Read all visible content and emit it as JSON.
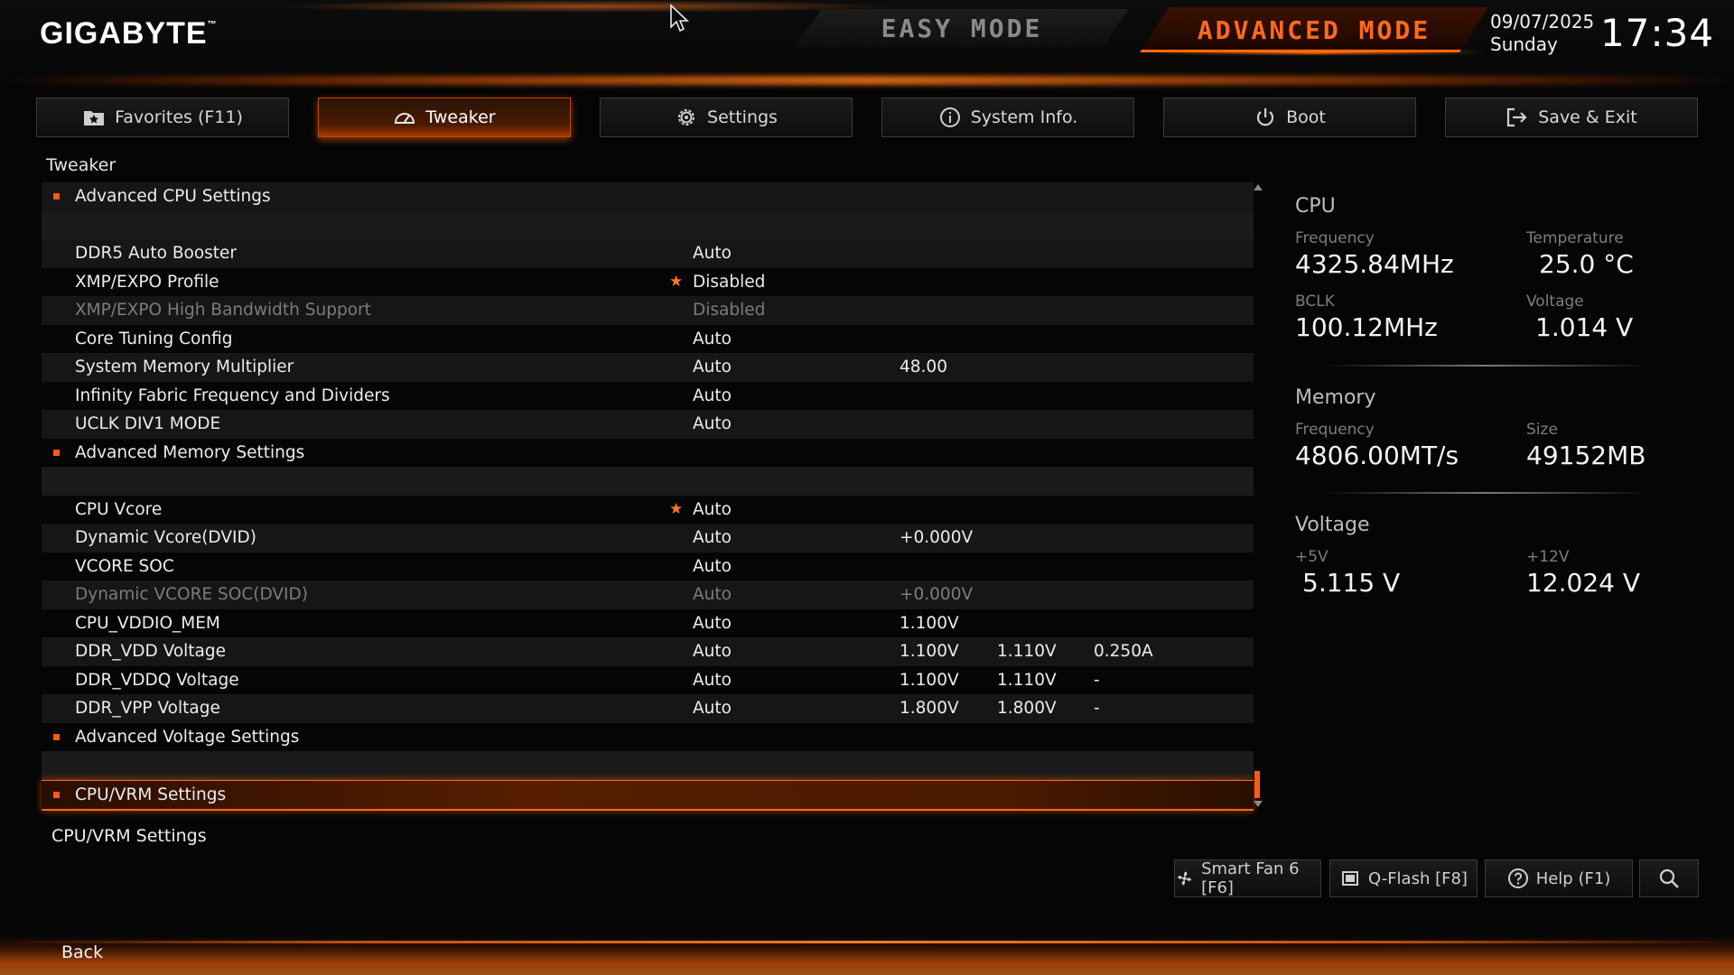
{
  "header": {
    "logo": "GIGABYTE",
    "logo_tm": "™",
    "easy_mode": "EASY MODE",
    "advanced_mode": "ADVANCED MODE",
    "date": "09/07/2025",
    "day": "Sunday",
    "time": "17:34"
  },
  "tabs": [
    {
      "label": "Favorites (F11)",
      "icon": "folder-star-icon"
    },
    {
      "label": "Tweaker",
      "icon": "speedometer-icon"
    },
    {
      "label": "Settings",
      "icon": "gear-icon"
    },
    {
      "label": "System Info.",
      "icon": "info-icon"
    },
    {
      "label": "Boot",
      "icon": "power-icon"
    },
    {
      "label": "Save & Exit",
      "icon": "exit-icon"
    }
  ],
  "breadcrumb": "Tweaker",
  "rows": [
    {
      "name": "Advanced CPU Settings",
      "submenu": true
    },
    {
      "blank": true
    },
    {
      "name": "DDR5 Auto Booster",
      "value": "Auto"
    },
    {
      "name": "XMP/EXPO Profile",
      "value": "Disabled",
      "starred": true
    },
    {
      "name": "XMP/EXPO High Bandwidth Support",
      "value": "Disabled",
      "disabled": true
    },
    {
      "name": "Core Tuning Config",
      "value": "Auto"
    },
    {
      "name": "System Memory Multiplier",
      "value": "Auto",
      "v2": "48.00"
    },
    {
      "name": "Infinity Fabric Frequency and Dividers",
      "value": "Auto"
    },
    {
      "name": "UCLK DIV1 MODE",
      "value": "Auto"
    },
    {
      "name": "Advanced Memory Settings",
      "submenu": true
    },
    {
      "blank": true
    },
    {
      "name": "CPU Vcore",
      "value": "Auto",
      "starred": true
    },
    {
      "name": "Dynamic Vcore(DVID)",
      "value": "Auto",
      "v2": "+0.000V"
    },
    {
      "name": "VCORE SOC",
      "value": "Auto"
    },
    {
      "name": "Dynamic VCORE SOC(DVID)",
      "value": "Auto",
      "v2": "+0.000V",
      "disabled": true
    },
    {
      "name": "CPU_VDDIO_MEM",
      "value": "Auto",
      "v2": "1.100V"
    },
    {
      "name": "DDR_VDD Voltage",
      "value": "Auto",
      "v2": "1.100V",
      "v3": "1.110V",
      "v4": "0.250A"
    },
    {
      "name": "DDR_VDDQ Voltage",
      "value": "Auto",
      "v2": "1.100V",
      "v3": "1.110V",
      "v4": "-"
    },
    {
      "name": "DDR_VPP Voltage",
      "value": "Auto",
      "v2": "1.800V",
      "v3": "1.800V",
      "v4": "-"
    },
    {
      "name": "Advanced Voltage Settings",
      "submenu": true
    },
    {
      "blank": true
    },
    {
      "name": "CPU/VRM Settings",
      "submenu": true,
      "selected": true
    }
  ],
  "help_text": "CPU/VRM Settings",
  "info": {
    "cpu": {
      "title": "CPU",
      "freq_label": "Frequency",
      "freq": "4325.84MHz",
      "temp_label": "Temperature",
      "temp": "25.0 °C",
      "bclk_label": "BCLK",
      "bclk": "100.12MHz",
      "volt_label": "Voltage",
      "volt": "1.014 V"
    },
    "memory": {
      "title": "Memory",
      "freq_label": "Frequency",
      "freq": "4806.00MT/s",
      "size_label": "Size",
      "size": "49152MB"
    },
    "voltage": {
      "title": "Voltage",
      "p5_label": "+5V",
      "p5": "5.115 V",
      "p12_label": "+12V",
      "p12": "12.024 V"
    }
  },
  "bottom_buttons": [
    {
      "label": "Smart Fan 6 [F6]",
      "icon": "fan-icon"
    },
    {
      "label": "Q-Flash [F8]",
      "icon": "chip-icon"
    },
    {
      "label": "Help (F1)",
      "icon": "help-icon"
    },
    {
      "label": "",
      "icon": "search-icon"
    }
  ],
  "footer": {
    "back": "Back"
  },
  "colors": {
    "accent": "#ff6a10",
    "background": "#050505",
    "text": "#ececec",
    "disabled": "#7c7c7c"
  }
}
